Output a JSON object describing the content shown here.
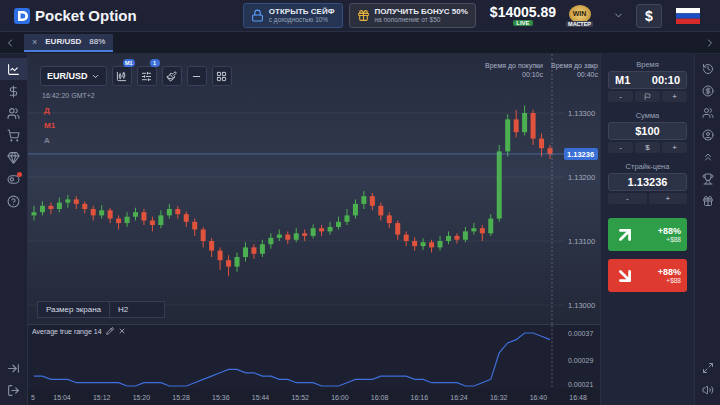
{
  "header": {
    "logo": "Pocket Option",
    "promos": [
      {
        "title": "ОТКРЫТЬ СЕЙФ",
        "subtitle": "с доходностью 10%"
      },
      {
        "title": "ПОЛУЧИТЬ БОНУС 50%",
        "subtitle": "на пополнение от $50"
      }
    ],
    "balance": "$14005.89",
    "account": "LIVE",
    "status": {
      "title": "WIN",
      "subtitle": "МАСТЕР"
    },
    "deposit": "$"
  },
  "tabs": [
    {
      "label": "EUR/USD",
      "payout": "88%",
      "close": "×",
      "selected": true
    }
  ],
  "left_rail": [
    {
      "selected": true,
      "notified": false
    },
    {
      "selected": false,
      "notified": false
    },
    {
      "selected": false,
      "notified": false
    },
    {
      "selected": false,
      "notified": false
    },
    {
      "selected": false,
      "notified": false
    },
    {
      "selected": false,
      "notified": true
    },
    {
      "selected": false,
      "notified": false
    }
  ],
  "chart": {
    "symbol": "EUR/USD",
    "timeframe_badge": "M1",
    "indicators_badge": "1",
    "clock": "16:42:20 GMT+2",
    "side_labels": [
      {
        "label": "Д",
        "color": "#e0453a"
      },
      {
        "label": "M1",
        "color": "#e0453a"
      },
      {
        "label": "A",
        "color": "#7d8499"
      }
    ],
    "timers": [
      {
        "label": "Время до покупки",
        "value": "00:10с"
      },
      {
        "label": "Время до закр",
        "value": "00:40с"
      }
    ],
    "price_ticks": [
      "1.13300",
      "1.13200",
      "1.13100",
      "1.13000"
    ],
    "current_price": "1.13236",
    "screen_size": {
      "label": "Размер экрана",
      "value": "H2"
    },
    "candles": [
      {
        "o": 1.1314,
        "h": 1.13155,
        "l": 1.13132,
        "c": 1.13145
      },
      {
        "o": 1.13145,
        "h": 1.13162,
        "l": 1.1314,
        "c": 1.13155
      },
      {
        "o": 1.13155,
        "h": 1.1316,
        "l": 1.13142,
        "c": 1.1315
      },
      {
        "o": 1.1315,
        "h": 1.13168,
        "l": 1.13145,
        "c": 1.1316
      },
      {
        "o": 1.1316,
        "h": 1.13172,
        "l": 1.13152,
        "c": 1.13165
      },
      {
        "o": 1.13165,
        "h": 1.1317,
        "l": 1.1315,
        "c": 1.13158
      },
      {
        "o": 1.13158,
        "h": 1.13162,
        "l": 1.13143,
        "c": 1.1315
      },
      {
        "o": 1.1315,
        "h": 1.13155,
        "l": 1.13132,
        "c": 1.1314
      },
      {
        "o": 1.1314,
        "h": 1.13156,
        "l": 1.13135,
        "c": 1.13148
      },
      {
        "o": 1.13148,
        "h": 1.13152,
        "l": 1.13128,
        "c": 1.13135
      },
      {
        "o": 1.13135,
        "h": 1.1314,
        "l": 1.13118,
        "c": 1.13128
      },
      {
        "o": 1.13128,
        "h": 1.13145,
        "l": 1.13122,
        "c": 1.13138
      },
      {
        "o": 1.13138,
        "h": 1.13152,
        "l": 1.13132,
        "c": 1.13145
      },
      {
        "o": 1.13145,
        "h": 1.1315,
        "l": 1.13125,
        "c": 1.13132
      },
      {
        "o": 1.13132,
        "h": 1.13138,
        "l": 1.13115,
        "c": 1.13125
      },
      {
        "o": 1.13125,
        "h": 1.13148,
        "l": 1.1312,
        "c": 1.1314
      },
      {
        "o": 1.1314,
        "h": 1.13158,
        "l": 1.13135,
        "c": 1.1315
      },
      {
        "o": 1.1315,
        "h": 1.13155,
        "l": 1.13135,
        "c": 1.13142
      },
      {
        "o": 1.13142,
        "h": 1.13146,
        "l": 1.13122,
        "c": 1.1313
      },
      {
        "o": 1.1313,
        "h": 1.13135,
        "l": 1.13108,
        "c": 1.13118
      },
      {
        "o": 1.13118,
        "h": 1.13122,
        "l": 1.1309,
        "c": 1.131
      },
      {
        "o": 1.131,
        "h": 1.13105,
        "l": 1.13075,
        "c": 1.13085
      },
      {
        "o": 1.13085,
        "h": 1.1309,
        "l": 1.13055,
        "c": 1.1307
      },
      {
        "o": 1.1307,
        "h": 1.13078,
        "l": 1.13045,
        "c": 1.1306
      },
      {
        "o": 1.1306,
        "h": 1.13082,
        "l": 1.13052,
        "c": 1.13075
      },
      {
        "o": 1.13075,
        "h": 1.13098,
        "l": 1.13068,
        "c": 1.1309
      },
      {
        "o": 1.1309,
        "h": 1.13095,
        "l": 1.13072,
        "c": 1.1308
      },
      {
        "o": 1.1308,
        "h": 1.13102,
        "l": 1.13075,
        "c": 1.13095
      },
      {
        "o": 1.13095,
        "h": 1.13112,
        "l": 1.13088,
        "c": 1.13105
      },
      {
        "o": 1.13105,
        "h": 1.13118,
        "l": 1.131,
        "c": 1.1311
      },
      {
        "o": 1.1311,
        "h": 1.13115,
        "l": 1.13095,
        "c": 1.13102
      },
      {
        "o": 1.13102,
        "h": 1.1312,
        "l": 1.13098,
        "c": 1.13112
      },
      {
        "o": 1.13112,
        "h": 1.13118,
        "l": 1.131,
        "c": 1.13108
      },
      {
        "o": 1.13108,
        "h": 1.13126,
        "l": 1.13104,
        "c": 1.1312
      },
      {
        "o": 1.1312,
        "h": 1.13125,
        "l": 1.13108,
        "c": 1.13115
      },
      {
        "o": 1.13115,
        "h": 1.1313,
        "l": 1.1311,
        "c": 1.13122
      },
      {
        "o": 1.13122,
        "h": 1.13138,
        "l": 1.13118,
        "c": 1.1313
      },
      {
        "o": 1.1313,
        "h": 1.1315,
        "l": 1.13125,
        "c": 1.1314
      },
      {
        "o": 1.1314,
        "h": 1.13165,
        "l": 1.13135,
        "c": 1.13158
      },
      {
        "o": 1.13158,
        "h": 1.13178,
        "l": 1.1315,
        "c": 1.1317
      },
      {
        "o": 1.1317,
        "h": 1.13175,
        "l": 1.13148,
        "c": 1.13155
      },
      {
        "o": 1.13155,
        "h": 1.1316,
        "l": 1.13132,
        "c": 1.1314
      },
      {
        "o": 1.1314,
        "h": 1.13145,
        "l": 1.1312,
        "c": 1.13128
      },
      {
        "o": 1.13128,
        "h": 1.13132,
        "l": 1.13102,
        "c": 1.1311
      },
      {
        "o": 1.1311,
        "h": 1.13115,
        "l": 1.13092,
        "c": 1.131
      },
      {
        "o": 1.131,
        "h": 1.13106,
        "l": 1.13085,
        "c": 1.13092
      },
      {
        "o": 1.13092,
        "h": 1.13104,
        "l": 1.13086,
        "c": 1.13098
      },
      {
        "o": 1.13098,
        "h": 1.13102,
        "l": 1.13082,
        "c": 1.1309
      },
      {
        "o": 1.1309,
        "h": 1.13108,
        "l": 1.13085,
        "c": 1.131
      },
      {
        "o": 1.131,
        "h": 1.13115,
        "l": 1.13095,
        "c": 1.13108
      },
      {
        "o": 1.13108,
        "h": 1.13112,
        "l": 1.13096,
        "c": 1.13102
      },
      {
        "o": 1.13102,
        "h": 1.13122,
        "l": 1.13098,
        "c": 1.13115
      },
      {
        "o": 1.13115,
        "h": 1.13128,
        "l": 1.1311,
        "c": 1.1312
      },
      {
        "o": 1.1312,
        "h": 1.13125,
        "l": 1.131,
        "c": 1.13112
      },
      {
        "o": 1.13112,
        "h": 1.13142,
        "l": 1.13108,
        "c": 1.13135
      },
      {
        "o": 1.13135,
        "h": 1.1325,
        "l": 1.1313,
        "c": 1.1324
      },
      {
        "o": 1.1324,
        "h": 1.13298,
        "l": 1.13232,
        "c": 1.1329
      },
      {
        "o": 1.1329,
        "h": 1.13305,
        "l": 1.13262,
        "c": 1.1327
      },
      {
        "o": 1.1327,
        "h": 1.13312,
        "l": 1.13265,
        "c": 1.133
      },
      {
        "o": 1.133,
        "h": 1.13305,
        "l": 1.1325,
        "c": 1.1326
      },
      {
        "o": 1.1326,
        "h": 1.13268,
        "l": 1.13232,
        "c": 1.13245
      },
      {
        "o": 1.13245,
        "h": 1.1325,
        "l": 1.13228,
        "c": 1.13236
      }
    ]
  },
  "indicator": {
    "name": "Average true range 14",
    "ticks": [
      "0.00037",
      "0.00029",
      "0.00021"
    ],
    "values": [
      0.00024,
      0.00024,
      0.00023,
      0.00023,
      0.00023,
      0.00022,
      0.00022,
      0.00022,
      0.00022,
      0.00022,
      0.00022,
      0.00021,
      0.00021,
      0.00022,
      0.00022,
      0.00022,
      0.00021,
      0.00021,
      0.00021,
      0.00022,
      0.00023,
      0.00024,
      0.00025,
      0.00026,
      0.00026,
      0.00025,
      0.00025,
      0.00024,
      0.00024,
      0.00023,
      0.00023,
      0.00022,
      0.00022,
      0.00022,
      0.00021,
      0.00021,
      0.00021,
      0.00022,
      0.00023,
      0.00023,
      0.00023,
      0.00024,
      0.00024,
      0.00024,
      0.00024,
      0.00023,
      0.00023,
      0.00022,
      0.00022,
      0.00022,
      0.00022,
      0.00021,
      0.00021,
      0.00022,
      0.00023,
      0.00031,
      0.00034,
      0.00035,
      0.00037,
      0.00037,
      0.00036,
      0.00035
    ]
  },
  "time_axis": [
    "5",
    "15:04",
    "15:12",
    "15:20",
    "15:28",
    "15:36",
    "15:44",
    "15:52",
    "16:00",
    "16:08",
    "16:16",
    "16:24",
    "16:32",
    "16:40",
    "16:48"
  ],
  "trade_panel": {
    "groups": [
      {
        "label": "Время",
        "lead": "M1",
        "value": "00:10",
        "controls": [
          {
            "kind": "button",
            "label": "-"
          },
          {
            "kind": "flag"
          },
          {
            "kind": "button",
            "label": "+"
          }
        ]
      },
      {
        "label": "Сумма",
        "lead": "",
        "value": "$100",
        "controls": [
          {
            "kind": "button",
            "label": "-"
          },
          {
            "kind": "button",
            "label": "$"
          },
          {
            "kind": "button",
            "label": "+"
          }
        ]
      },
      {
        "label": "Страйк-цена",
        "lead": "",
        "value": "1.13236",
        "controls": [
          {
            "kind": "button",
            "label": "-"
          },
          {
            "kind": "button",
            "label": "+"
          }
        ]
      }
    ],
    "buttons": [
      {
        "kind": "call",
        "percent": "+88%",
        "profit": "+$88",
        "color": "#2f9e49"
      },
      {
        "kind": "put",
        "percent": "+88%",
        "profit": "+$88",
        "color": "#de3a30"
      }
    ]
  }
}
